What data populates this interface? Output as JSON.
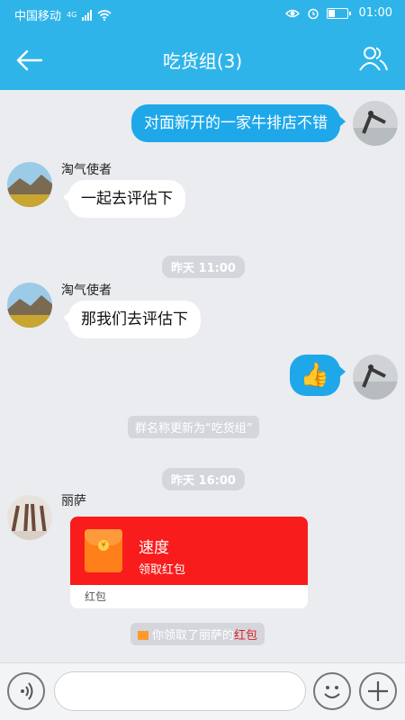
{
  "status": {
    "carrier": "中国移动",
    "network": "4G",
    "time": "01:00"
  },
  "header": {
    "title": "吃货组(3)",
    "back_icon": "back-arrow-icon",
    "members_icon": "people-icon"
  },
  "messages": {
    "m1": {
      "text": "对面新开的一家牛排店不错"
    },
    "m2": {
      "sender": "淘气使者",
      "text": "一起去评估下"
    },
    "t1": "昨天 11:00",
    "m3": {
      "sender": "淘气使者",
      "text": "那我们去评估下"
    },
    "m4": {
      "emoji": "👍"
    },
    "sys1": "群名称更新为“吃货组”",
    "t2": "昨天 16:00",
    "m5": {
      "sender": "丽萨",
      "packet_title": "速度",
      "packet_sub": "领取红包",
      "packet_foot": "红包"
    },
    "sys2": {
      "prefix": "你领取了丽萨的",
      "link": "红包"
    }
  },
  "colors": {
    "header": "#2fb4e9",
    "my_bubble": "#1ea8ea",
    "red_packet": "#f81c1c",
    "link_red": "#e02020"
  }
}
